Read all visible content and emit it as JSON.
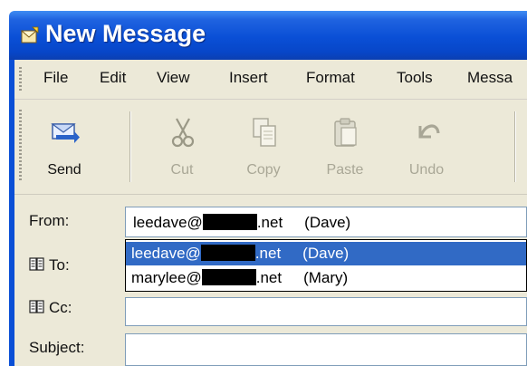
{
  "window": {
    "title": "New Message"
  },
  "menu": {
    "items": [
      "File",
      "Edit",
      "View",
      "Insert",
      "Format",
      "Tools",
      "Messa"
    ]
  },
  "toolbar": {
    "buttons": [
      {
        "label": "Send",
        "icon": "send-icon",
        "enabled": true
      },
      {
        "label": "Cut",
        "icon": "scissors-icon",
        "enabled": false
      },
      {
        "label": "Copy",
        "icon": "copy-icon",
        "enabled": false
      },
      {
        "label": "Paste",
        "icon": "paste-icon",
        "enabled": false
      },
      {
        "label": "Undo",
        "icon": "undo-icon",
        "enabled": false
      }
    ]
  },
  "fields": {
    "from_label": "From:",
    "to_label": "To:",
    "cc_label": "Cc:",
    "subject_label": "Subject:",
    "from_value": {
      "user": "leedave@",
      "domain": ".net",
      "name": "(Dave)"
    },
    "to_value": "",
    "cc_value": "",
    "subject_value": ""
  },
  "from_dropdown": {
    "options": [
      {
        "user": "leedave@",
        "domain": ".net",
        "name": "(Dave)",
        "selected": true
      },
      {
        "user": "marylee@",
        "domain": ".net",
        "name": "(Mary)",
        "selected": false
      }
    ]
  },
  "colors": {
    "titlebar": "#0a4fd6",
    "selection": "#316ac5",
    "chrome": "#ece9d8"
  }
}
